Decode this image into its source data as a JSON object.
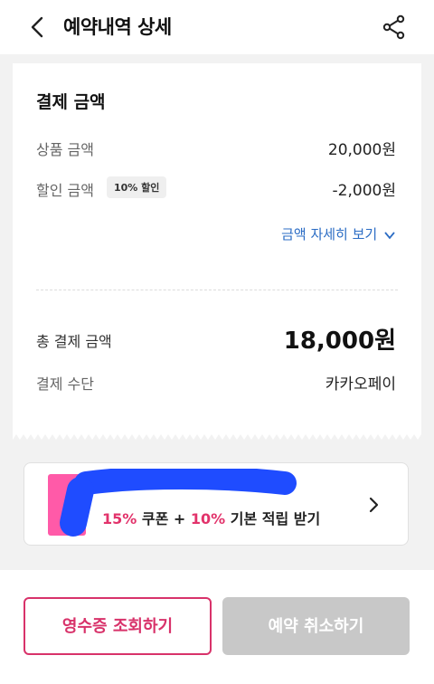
{
  "header": {
    "title": "예약내역 상세",
    "back_icon": "chevron-left-icon",
    "share_icon": "share-icon"
  },
  "payment": {
    "section_title": "결제 금액",
    "product_label": "상품 금액",
    "product_value": "20,000원",
    "discount_label": "할인 금액",
    "discount_badge": "10% 할인",
    "discount_value": "-2,000원",
    "detail_link": "금액 자세히 보기",
    "total_label": "총 결제 금액",
    "total_value": "18,000원",
    "method_label": "결제 수단",
    "method_value": "카카오페이"
  },
  "promo": {
    "coupon_pct": "15%",
    "coupon_text": " 쿠폰 + ",
    "reward_pct": "10%",
    "reward_text": " 기본 적립 받기",
    "arrow_icon": "chevron-right-icon"
  },
  "buttons": {
    "receipt": "영수증 조회하기",
    "cancel": "예약 취소하기"
  },
  "colors": {
    "accent_pink": "#d8326a",
    "link_blue": "#2b6cc4",
    "disabled_gray": "#c8c8c8",
    "scribble_blue": "#1f4cff"
  }
}
